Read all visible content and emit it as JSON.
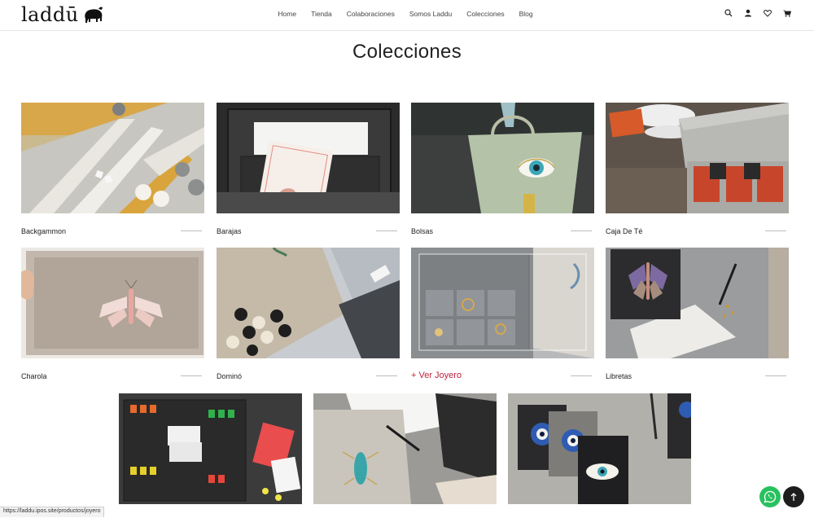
{
  "brand": {
    "name": "laddū",
    "logo_icon": "elephant-icon"
  },
  "nav": {
    "items": [
      {
        "label": "Home"
      },
      {
        "label": "Tienda"
      },
      {
        "label": "Colaboraciones"
      },
      {
        "label": "Somos Laddu"
      },
      {
        "label": "Colecciones"
      },
      {
        "label": "Blog"
      }
    ]
  },
  "header_icons": [
    "search-icon",
    "user-icon",
    "heart-icon",
    "cart-icon"
  ],
  "page": {
    "title": "Colecciones"
  },
  "collections": [
    {
      "label": "Backgammon"
    },
    {
      "label": "Barajas"
    },
    {
      "label": "Bolsas"
    },
    {
      "label": "Caja De Té"
    },
    {
      "label": "Charola"
    },
    {
      "label": "Dominó"
    },
    {
      "label": "+ Ver Joyero"
    },
    {
      "label": "Libretas"
    }
  ],
  "status_bar": {
    "url": "https://laddu.ipos.site/productos/joyero"
  },
  "colors": {
    "accent": "#c3203b",
    "whatsapp": "#29c15f"
  }
}
